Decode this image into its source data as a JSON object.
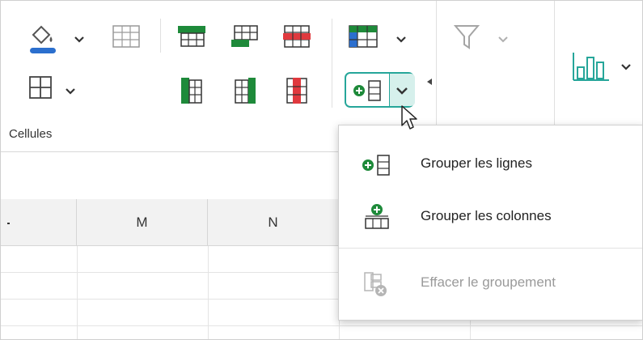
{
  "ribbon": {
    "cells_group_label": "Cellules"
  },
  "columns": [
    {
      "label": ""
    },
    {
      "label": "M"
    },
    {
      "label": "N"
    },
    {
      "label": ""
    },
    {
      "label": ""
    }
  ],
  "group_menu": {
    "items": [
      {
        "label": "Grouper les lignes",
        "icon": "group-rows-icon",
        "enabled": true
      },
      {
        "label": "Grouper les colonnes",
        "icon": "group-columns-icon",
        "enabled": true
      },
      {
        "label": "Effacer le groupement",
        "icon": "clear-grouping-icon",
        "enabled": false
      }
    ]
  },
  "colors": {
    "accent": "#26a69a",
    "fill_blue": "#2b6fce",
    "green": "#1e8a3a",
    "red": "#e0393e"
  }
}
